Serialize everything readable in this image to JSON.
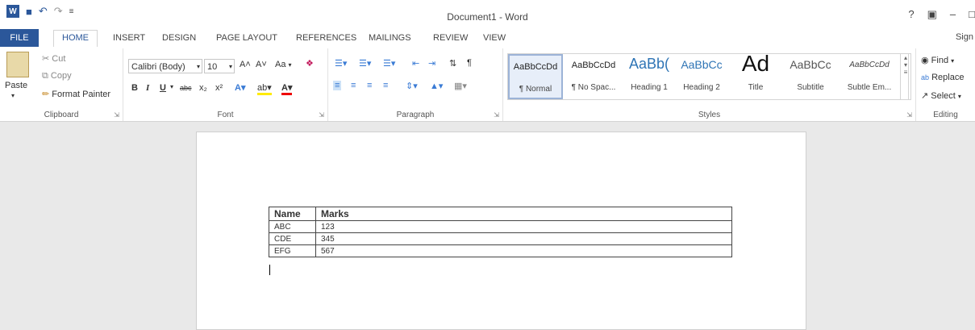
{
  "window": {
    "title": "Document1 - Word",
    "help": "?",
    "controls": [
      "–",
      "□"
    ]
  },
  "qat": {
    "logo": "W",
    "save": "💾",
    "undo": "↶",
    "redo": "↷",
    "customize": "≡"
  },
  "tabs": [
    "FILE",
    "HOME",
    "INSERT",
    "DESIGN",
    "PAGE LAYOUT",
    "REFERENCES",
    "MAILINGS",
    "REVIEW",
    "VIEW"
  ],
  "sign_in": "Sign",
  "clipboard": {
    "paste": "Paste",
    "cut": "Cut",
    "copy": "Copy",
    "format_painter": "Format Painter",
    "label": "Clipboard"
  },
  "font": {
    "name": "Calibri (Body)",
    "size": "10",
    "grow": "A˄",
    "shrink": "A˅",
    "case": "Aa",
    "bold": "B",
    "italic": "I",
    "underline": "U",
    "strike": "abc",
    "sub": "x₂",
    "sup": "x²",
    "label": "Font"
  },
  "paragraph": {
    "label": "Paragraph"
  },
  "styles": {
    "label": "Styles",
    "items": [
      {
        "sample": "AaBbCcDd",
        "name": "¶ Normal"
      },
      {
        "sample": "AaBbCcDd",
        "name": "¶ No Spac..."
      },
      {
        "sample": "AaBb(",
        "name": "Heading 1"
      },
      {
        "sample": "AaBbCc",
        "name": "Heading 2"
      },
      {
        "sample": "Ad",
        "name": "Title"
      },
      {
        "sample": "AaBbCc",
        "name": "Subtitle"
      },
      {
        "sample": "AaBbCcDd",
        "name": "Subtle Em..."
      }
    ]
  },
  "editing": {
    "find": "Find",
    "replace": "Replace",
    "select": "Select",
    "label": "Editing"
  },
  "table": {
    "headers": [
      "Name",
      "Marks"
    ],
    "rows": [
      [
        "ABC",
        "123"
      ],
      [
        "CDE",
        "345"
      ],
      [
        "EFG",
        "567"
      ]
    ]
  }
}
